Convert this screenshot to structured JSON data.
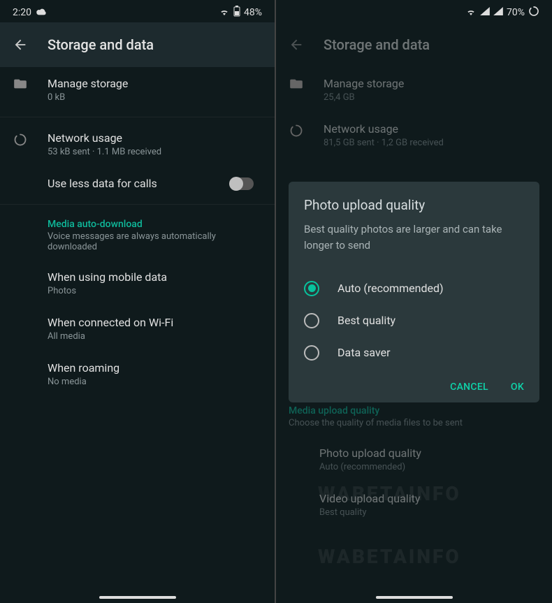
{
  "left": {
    "status": {
      "time": "2:20",
      "battery": "48%"
    },
    "title": "Storage and data",
    "manage": {
      "title": "Manage storage",
      "sub": "0 kB"
    },
    "network": {
      "title": "Network usage",
      "sub": "53 kB sent · 1.1 MB received"
    },
    "lessdata": "Use less data for calls",
    "section": {
      "label": "Media auto-download",
      "hint": "Voice messages are always automatically downloaded"
    },
    "mobile": {
      "title": "When using mobile data",
      "sub": "Photos"
    },
    "wifi": {
      "title": "When connected on Wi-Fi",
      "sub": "All media"
    },
    "roaming": {
      "title": "When roaming",
      "sub": "No media"
    }
  },
  "right": {
    "status": {
      "battery": "70%"
    },
    "title": "Storage and data",
    "manage": {
      "title": "Manage storage",
      "sub": "25,4 GB"
    },
    "network": {
      "title": "Network usage",
      "sub": "81,5 GB sent · 1,2 GB received"
    },
    "upload_section": {
      "label": "Media upload quality",
      "hint": "Choose the quality of media files to be sent"
    },
    "photo": {
      "title": "Photo upload quality",
      "sub": "Auto (recommended)"
    },
    "video": {
      "title": "Video upload quality",
      "sub": "Best quality"
    },
    "dialog": {
      "title": "Photo upload quality",
      "desc": "Best quality photos are larger and can take longer to send",
      "opts": [
        "Auto (recommended)",
        "Best quality",
        "Data saver"
      ],
      "cancel": "CANCEL",
      "ok": "OK"
    }
  },
  "watermark": "WABETAINFO"
}
